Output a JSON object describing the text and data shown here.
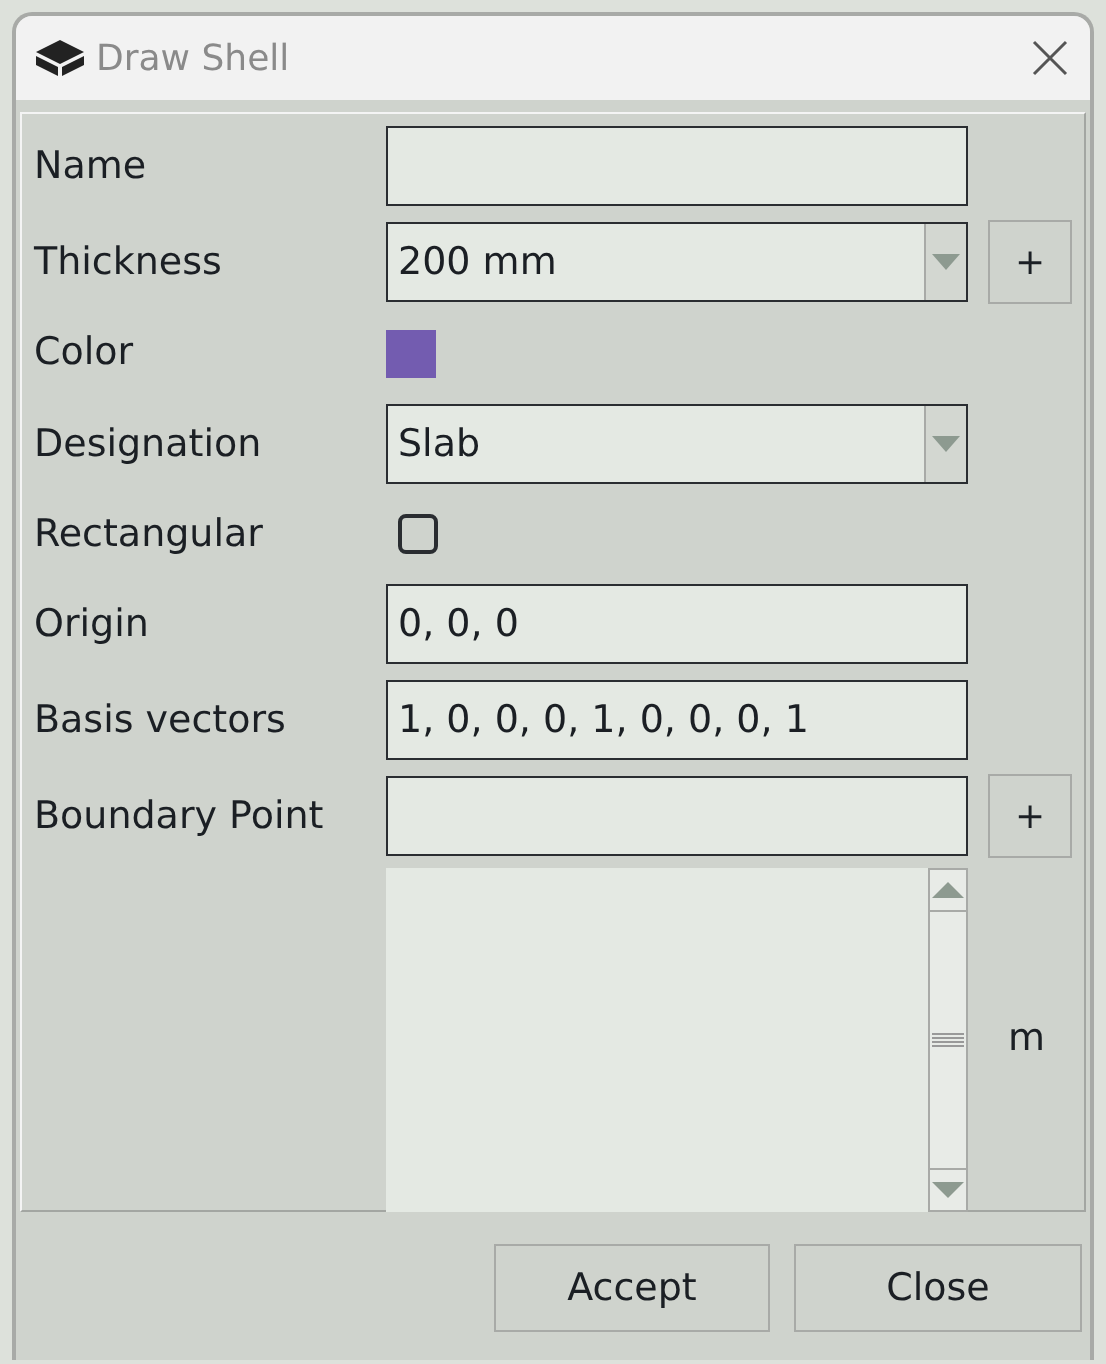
{
  "window": {
    "title": "Draw Shell"
  },
  "fields": [
    {
      "kind": "text",
      "label": "Name"
    },
    {
      "kind": "combo",
      "label": "Thickness",
      "value": "200 mm",
      "add_button": "+"
    },
    {
      "kind": "color",
      "label": "Color",
      "color": "#735cb0"
    },
    {
      "kind": "combo",
      "label": "Designation",
      "value": "Slab"
    },
    {
      "kind": "checkbox",
      "label": "Rectangular",
      "checked": false
    },
    {
      "kind": "text",
      "label": "Origin",
      "value": "0, 0, 0"
    },
    {
      "kind": "text",
      "label": "Basis vectors",
      "value": "1, 0, 0, 0, 1, 0, 0, 0, 1"
    },
    {
      "kind": "text",
      "label": "Boundary Point",
      "add_button": "+"
    }
  ],
  "point_list": {
    "unit": "m"
  },
  "buttons": [
    "Accept",
    "Close"
  ]
}
